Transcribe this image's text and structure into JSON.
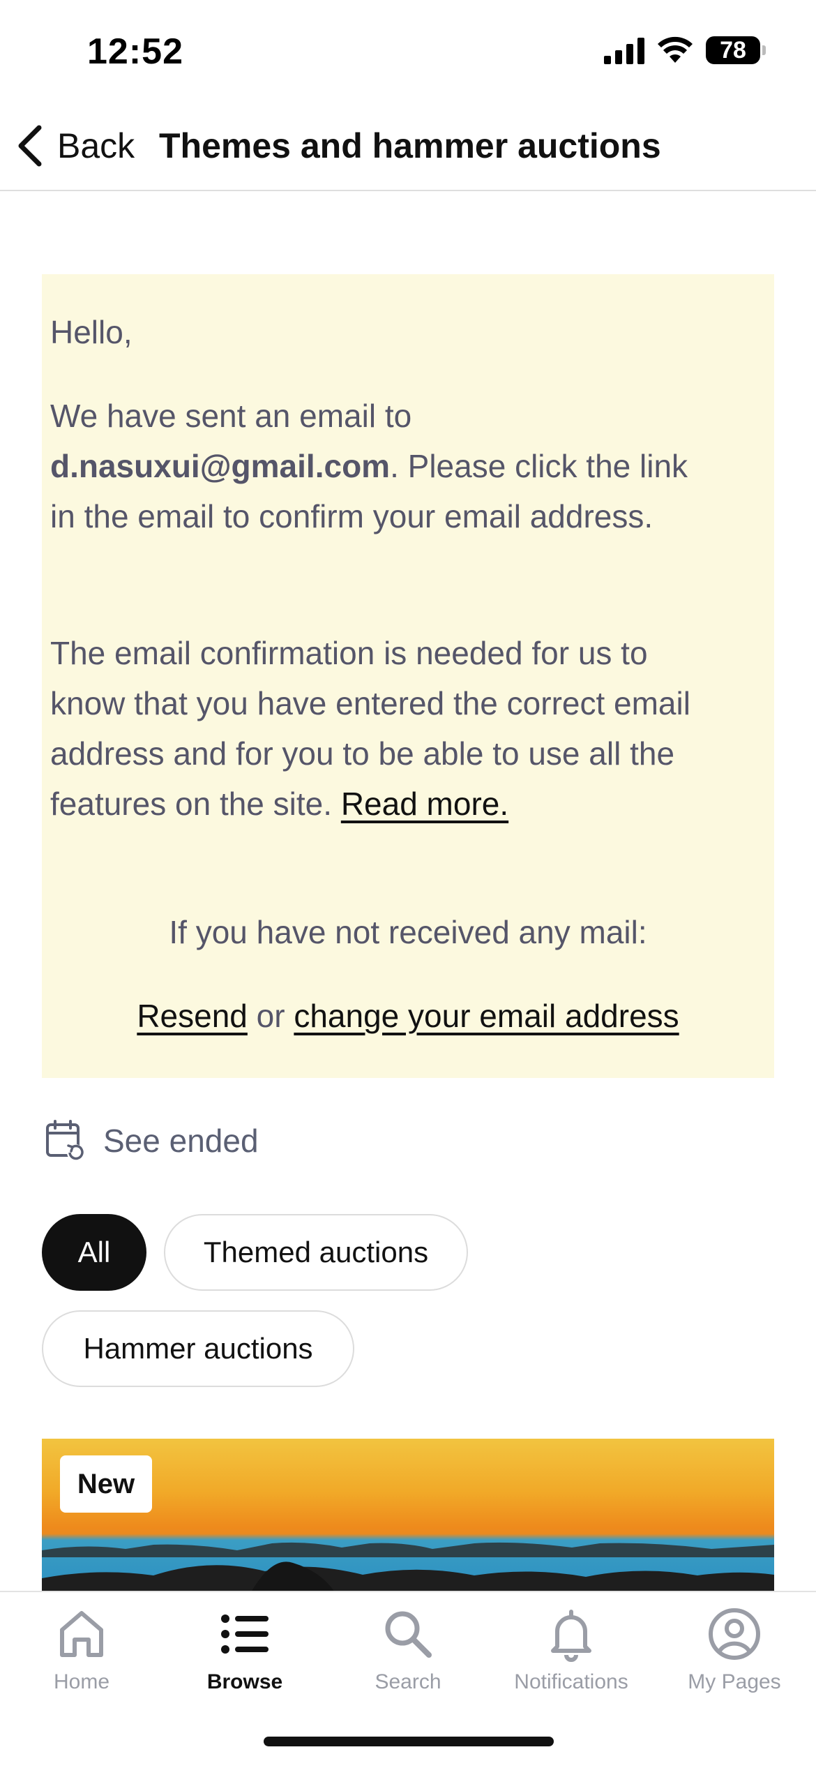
{
  "status_bar": {
    "time": "12:52",
    "battery": "78"
  },
  "nav": {
    "back_label": "Back",
    "title": "Themes and hammer auctions"
  },
  "notice": {
    "greeting": "Hello,",
    "sent_prefix": "We have sent an email to ",
    "email": "d.nasuxui@gmail.com",
    "sent_suffix": ". Please click the link in the email to confirm your email address.",
    "explain": "The email confirmation is needed for us to know that you have entered the correct email address and for you to be able to use all the features on the site. ",
    "read_more": "Read more.",
    "not_received": "If you have not received any mail:",
    "resend": "Resend",
    "or": " or ",
    "change_email": "change your email address"
  },
  "see_ended": {
    "label": "See ended",
    "icon": "calendar-refresh-icon"
  },
  "filters": {
    "all": "All",
    "themed": "Themed auctions",
    "hammer": "Hammer auctions"
  },
  "card": {
    "badge": "New"
  },
  "tabbar": {
    "home": "Home",
    "browse": "Browse",
    "search": "Search",
    "notifications": "Notifications",
    "my_pages": "My Pages"
  }
}
